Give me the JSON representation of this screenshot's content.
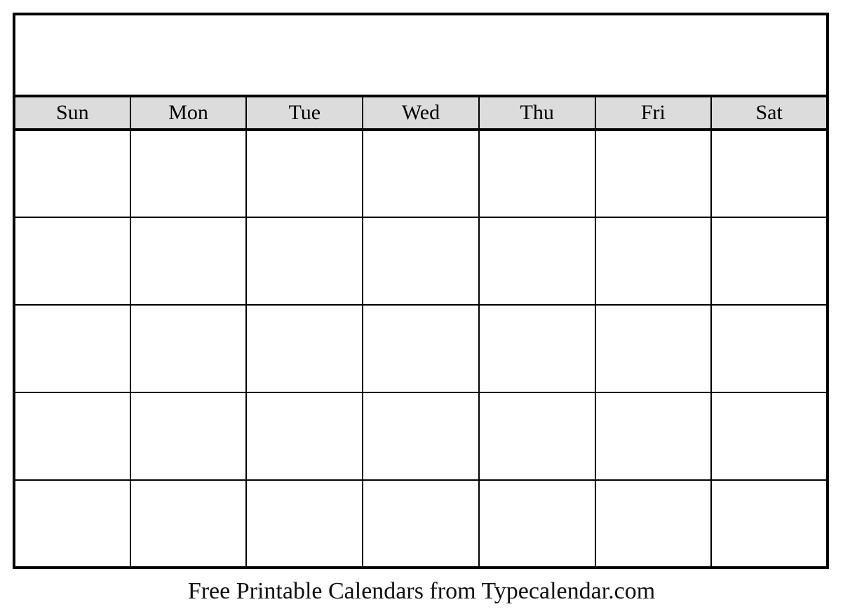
{
  "document": {
    "type": "blank-monthly-calendar",
    "title_text": "",
    "week_start": "Sun"
  },
  "colors": {
    "page_background": "#ffffff",
    "border": "#000000",
    "weekday_header_background": "#dcdcdc",
    "text": "#000000",
    "footer_text": "#111111"
  },
  "weekdays": [
    {
      "label": "Sun"
    },
    {
      "label": "Mon"
    },
    {
      "label": "Tue"
    },
    {
      "label": "Wed"
    },
    {
      "label": "Thu"
    },
    {
      "label": "Fri"
    },
    {
      "label": "Sat"
    }
  ],
  "weeks": [
    {
      "days": [
        {
          "date": ""
        },
        {
          "date": ""
        },
        {
          "date": ""
        },
        {
          "date": ""
        },
        {
          "date": ""
        },
        {
          "date": ""
        },
        {
          "date": ""
        }
      ]
    },
    {
      "days": [
        {
          "date": ""
        },
        {
          "date": ""
        },
        {
          "date": ""
        },
        {
          "date": ""
        },
        {
          "date": ""
        },
        {
          "date": ""
        },
        {
          "date": ""
        }
      ]
    },
    {
      "days": [
        {
          "date": ""
        },
        {
          "date": ""
        },
        {
          "date": ""
        },
        {
          "date": ""
        },
        {
          "date": ""
        },
        {
          "date": ""
        },
        {
          "date": ""
        }
      ]
    },
    {
      "days": [
        {
          "date": ""
        },
        {
          "date": ""
        },
        {
          "date": ""
        },
        {
          "date": ""
        },
        {
          "date": ""
        },
        {
          "date": ""
        },
        {
          "date": ""
        }
      ]
    },
    {
      "days": [
        {
          "date": ""
        },
        {
          "date": ""
        },
        {
          "date": ""
        },
        {
          "date": ""
        },
        {
          "date": ""
        },
        {
          "date": ""
        },
        {
          "date": ""
        }
      ]
    }
  ],
  "footer": {
    "credit": "Free Printable Calendars from Typecalendar.com"
  }
}
